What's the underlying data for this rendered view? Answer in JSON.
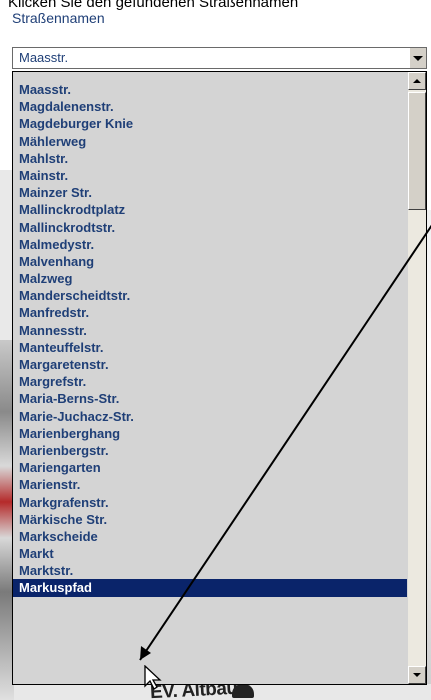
{
  "header": {
    "instruction_cut": "Klicken Sie den gefundenen Straßennamen",
    "section_label": "Straßennamen"
  },
  "select": {
    "value": "Maasstr."
  },
  "list": {
    "items": [
      "Maasstr.",
      "Magdalenenstr.",
      "Magdeburger Knie",
      "Mählerweg",
      "Mahlstr.",
      "Mainstr.",
      "Mainzer Str.",
      "Mallinckrodtplatz",
      "Mallinckrodtstr.",
      "Malmedystr.",
      "Malvenhang",
      "Malzweg",
      "Manderscheidtstr.",
      "Manfredstr.",
      "Mannesstr.",
      "Manteuffelstr.",
      "Margaretenstr.",
      "Margrefstr.",
      "Maria-Berns-Str.",
      "Marie-Juchacz-Str.",
      "Marienberghang",
      "Marienbergstr.",
      "Mariengarten",
      "Marienstr.",
      "Markgrafenstr.",
      "Märkische Str.",
      "Markscheide",
      "Markt",
      "Marktstr.",
      "Markuspfad"
    ],
    "selected_index": 29
  },
  "map": {
    "bottom_label": "EV. Altbau"
  },
  "colors": {
    "item_text": "#1f3f77",
    "selected_bg": "#0a246a",
    "list_bg": "#d4d4d4"
  }
}
